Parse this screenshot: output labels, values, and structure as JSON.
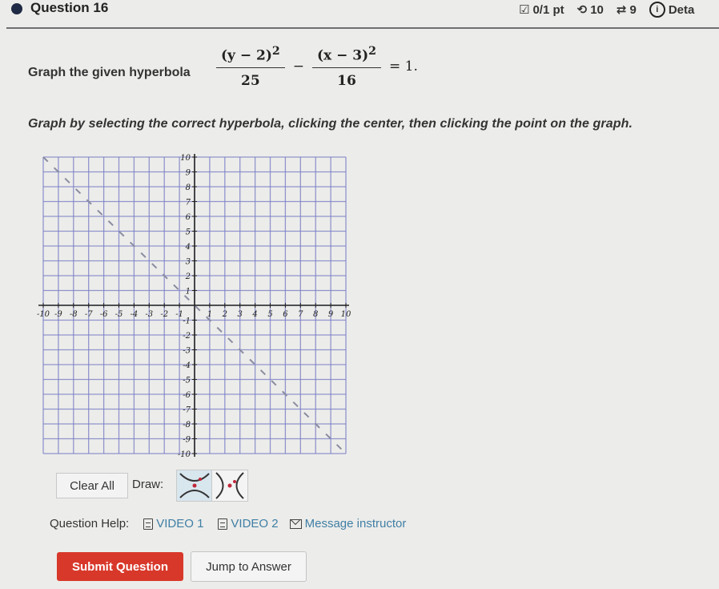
{
  "header": {
    "question_title": "Question 16",
    "score": "0/1 pt",
    "retries": "10",
    "attempts": "9",
    "details_label": "Deta",
    "icons": {
      "score": "checkbox-icon",
      "retries": "retry-icon",
      "attempts": "arrows-cycle-icon",
      "details": "info-icon"
    }
  },
  "question": {
    "prompt": "Graph the given hyperbola",
    "formula": {
      "term1_numerator": "(y − 2)",
      "term1_exponent": "2",
      "term1_denominator": "25",
      "operator": "−",
      "term2_numerator": "(x − 3)",
      "term2_exponent": "2",
      "term2_denominator": "16",
      "rhs": "= 1."
    },
    "instruction": "Graph by selecting the correct hyperbola, clicking the center, then clicking the point on the graph."
  },
  "graph": {
    "x_range": [
      -10,
      10
    ],
    "y_range": [
      -10,
      10
    ],
    "x_tick_labels": [
      "-10",
      "-9",
      "-8",
      "-7",
      "-6",
      "-5",
      "-4",
      "-3",
      "-2",
      "-1",
      "1",
      "2",
      "3",
      "4",
      "5",
      "6",
      "7",
      "8",
      "9",
      "10"
    ],
    "y_tick_labels": [
      "10",
      "9",
      "8",
      "7",
      "6",
      "5",
      "4",
      "3",
      "2",
      "1",
      "-1",
      "-2",
      "-3",
      "-4",
      "-5",
      "-6",
      "-7",
      "-8",
      "-9",
      "-10"
    ],
    "dashed_line": {
      "from": [
        -10,
        10
      ],
      "to": [
        10,
        -10
      ]
    },
    "colors": {
      "grid": "#7b7fc6",
      "axis": "#222222",
      "dashed": "#8a8ca0"
    }
  },
  "toolbar": {
    "clear_label": "Clear All",
    "draw_label": "Draw:",
    "tools": [
      {
        "name": "vertical-hyperbola-tool",
        "selected": true
      },
      {
        "name": "horizontal-hyperbola-tool",
        "selected": false
      }
    ]
  },
  "help": {
    "label": "Question Help:",
    "video1": "VIDEO 1",
    "video2": "VIDEO 2",
    "message": "Message instructor"
  },
  "actions": {
    "submit": "Submit Question",
    "jump": "Jump to Answer"
  },
  "colors": {
    "submit_bg": "#d8382a",
    "link": "#3f7fa5",
    "selected_tool_bg": "#d8e6ee"
  }
}
